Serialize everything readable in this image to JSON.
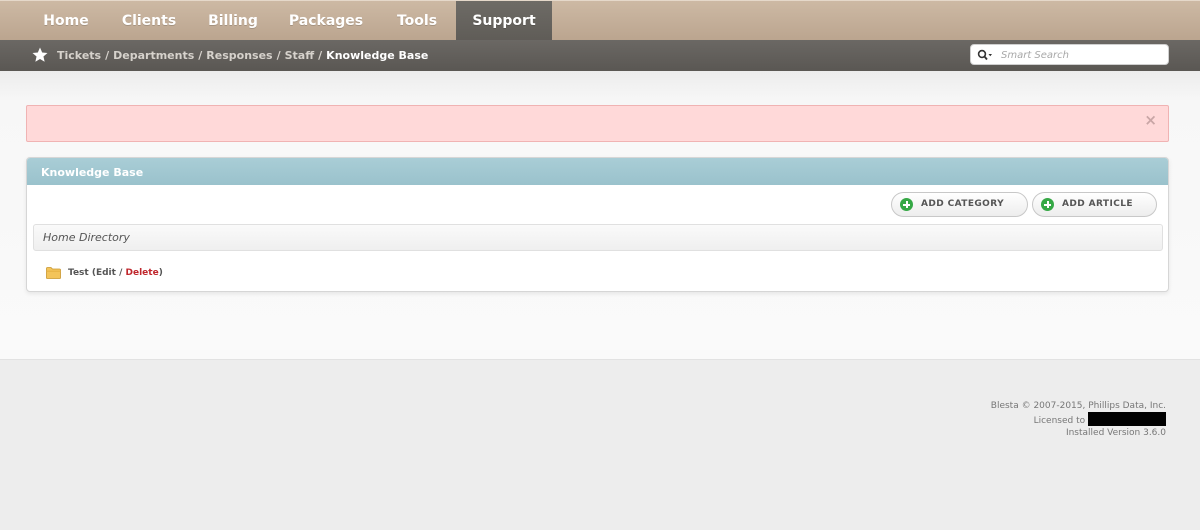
{
  "topnav": {
    "tabs": [
      {
        "label": "Home"
      },
      {
        "label": "Clients"
      },
      {
        "label": "Billing"
      },
      {
        "label": "Packages"
      },
      {
        "label": "Tools"
      },
      {
        "label": "Support",
        "active": true
      }
    ]
  },
  "breadcrumb": {
    "links": [
      "Tickets",
      "Departments",
      "Responses",
      "Staff",
      "Knowledge Base"
    ],
    "separator": "/"
  },
  "search": {
    "placeholder": "Smart Search"
  },
  "alert": {
    "close_glyph": "×"
  },
  "panel": {
    "title": "Knowledge Base",
    "add_category_label": "ADD CATEGORY",
    "add_article_label": "ADD ARTICLE",
    "directory_label": "Home Directory",
    "categories": [
      {
        "name": "Test",
        "edit_label": "Edit",
        "delete_label": "Delete"
      }
    ]
  },
  "footer": {
    "copyright": "Blesta © 2007-2015, Phillips Data, Inc.",
    "licensed_to": "Licensed to",
    "version": "Installed Version 3.6.0"
  },
  "colors": {
    "topnav_bg": "#c2ad97",
    "subnav_bg": "#625f5b",
    "panel_header": "#a3c9d3",
    "alert_bg": "#ffd9d9",
    "delete_link": "#c0272d",
    "add_icon": "#35a845"
  },
  "icons": [
    "star-icon",
    "search-icon",
    "close-icon",
    "plus-icon",
    "folder-icon"
  ]
}
